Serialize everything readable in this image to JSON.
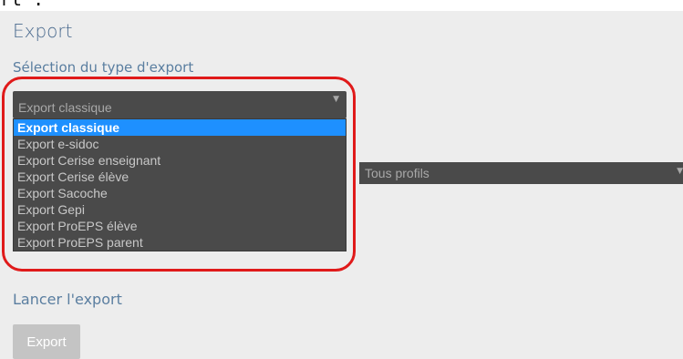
{
  "top_caption": "rt :",
  "header": {
    "title": "Export"
  },
  "export_type": {
    "section_label": "Sélection du type d'export",
    "selected_value": "Export classique",
    "options": [
      "Export classique",
      "Export e-sidoc",
      "Export Cerise enseignant",
      "Export Cerise élève",
      "Export Sacoche",
      "Export Gepi",
      "Export ProEPS élève",
      "Export ProEPS parent"
    ],
    "highlighted_index": 0,
    "arrow_icon": "triangle-down-icon"
  },
  "profile": {
    "selected_value": "Tous profils",
    "arrow_icon": "triangle-down-icon"
  },
  "launch": {
    "section_label": "Lancer l'export",
    "button_label": "Export"
  },
  "colors": {
    "panel_background": "#ededed",
    "heading_text": "#4a6a8e",
    "select_background": "#4a4a4a",
    "option_highlight": "#1e90ff",
    "annotation_ring": "#e01a1a",
    "button_background": "#c4c4c4"
  }
}
